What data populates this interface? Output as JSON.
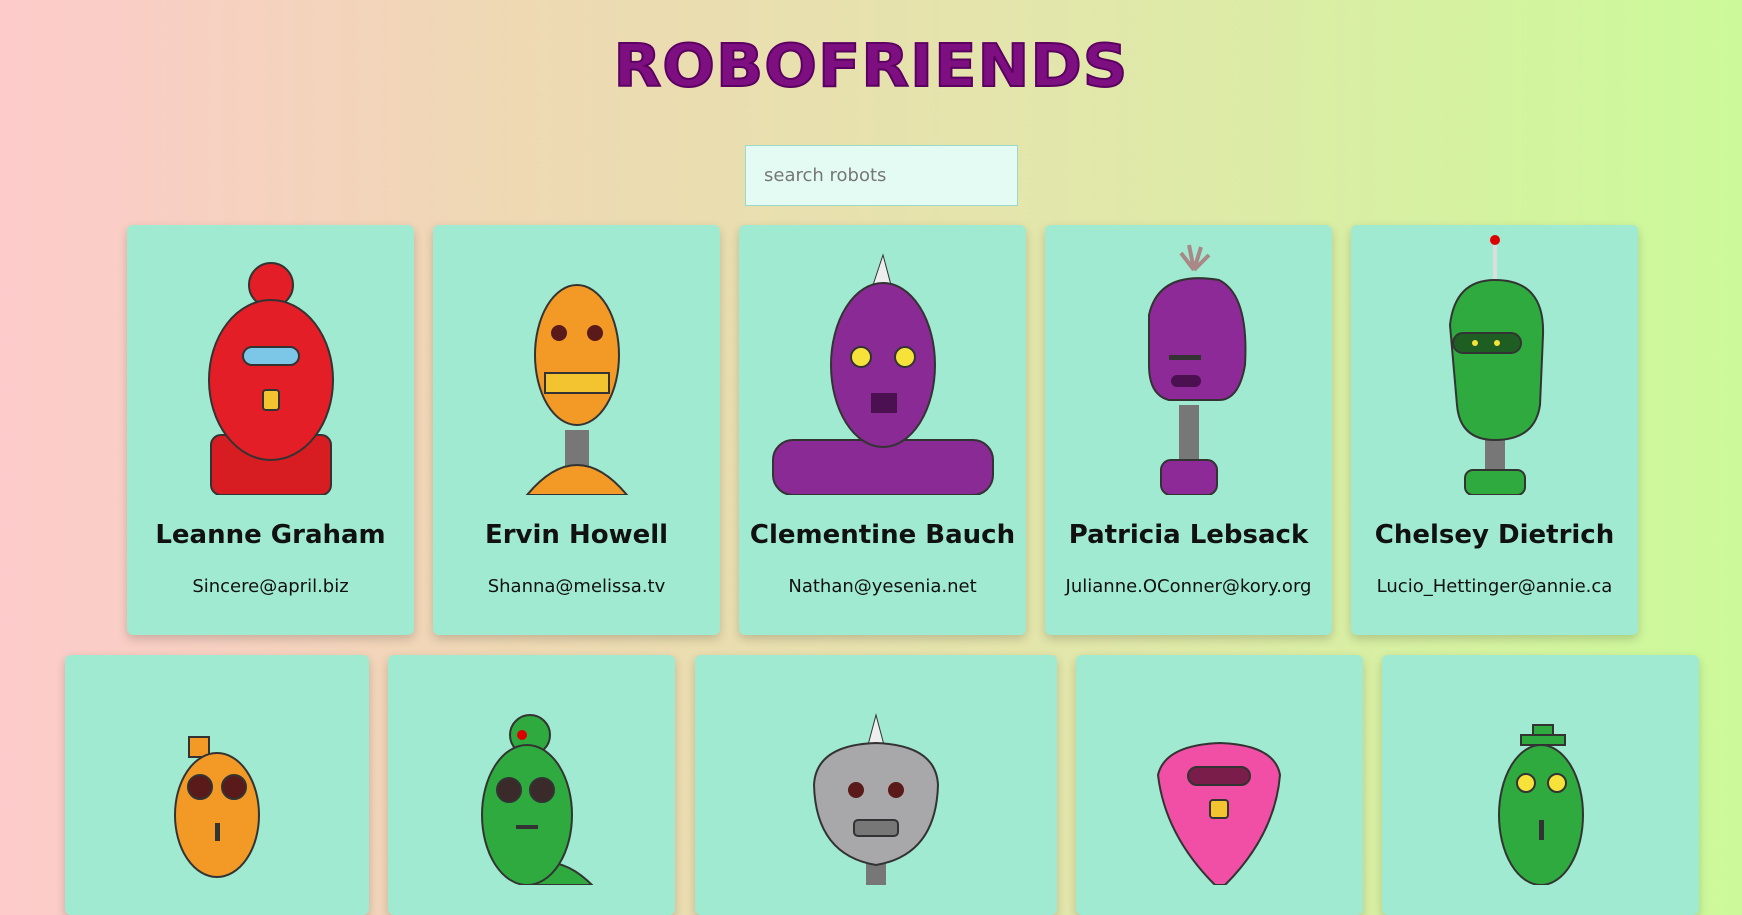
{
  "header": {
    "title": "ROBOFRIENDS"
  },
  "search": {
    "placeholder": "search robots",
    "value": ""
  },
  "robots": [
    {
      "name": "Leanne Graham",
      "email": "Sincere@april.biz",
      "color": "#e41e26",
      "icon": "red-robot-avatar"
    },
    {
      "name": "Ervin Howell",
      "email": "Shanna@melissa.tv",
      "color": "#f39a26",
      "icon": "orange-robot-avatar"
    },
    {
      "name": "Clementine Bauch",
      "email": "Nathan@yesenia.net",
      "color": "#8a2a95",
      "icon": "purple-robot-avatar"
    },
    {
      "name": "Patricia Lebsack",
      "email": "Julianne.OConner@kory.org",
      "color": "#8e2a98",
      "icon": "purple-robot-avatar"
    },
    {
      "name": "Chelsey Dietrich",
      "email": "Lucio_Hettinger@annie.ca",
      "color": "#2faa3e",
      "icon": "green-robot-avatar"
    },
    {
      "name": "",
      "email": "",
      "color": "#f39a26",
      "icon": "orange-robot-avatar"
    },
    {
      "name": "",
      "email": "",
      "color": "#2faa3e",
      "icon": "green-robot-avatar"
    },
    {
      "name": "",
      "email": "",
      "color": "#a8a8ab",
      "icon": "gray-robot-avatar"
    },
    {
      "name": "",
      "email": "",
      "color": "#f04fa5",
      "icon": "pink-robot-avatar"
    },
    {
      "name": "",
      "email": "",
      "color": "#2faa3e",
      "icon": "green-robot-avatar"
    }
  ]
}
